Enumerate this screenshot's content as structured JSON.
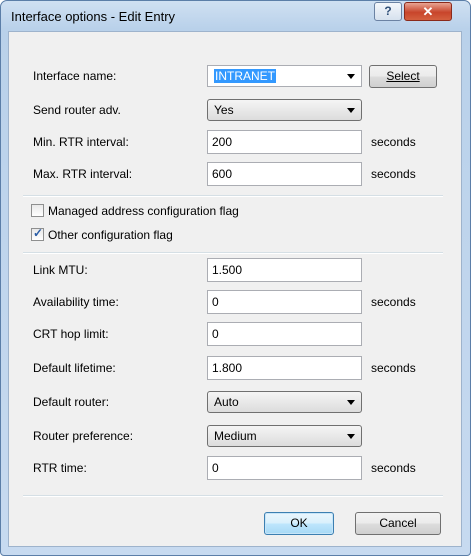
{
  "window": {
    "title": "Interface options - Edit Entry",
    "help_glyph": "?",
    "close_glyph": "✕"
  },
  "form": {
    "interface_name": {
      "label": "Interface name:",
      "value": "INTRANET",
      "select_button": "Select"
    },
    "send_router_adv": {
      "label": "Send router adv.",
      "value": "Yes"
    },
    "min_rtr_interval": {
      "label": "Min. RTR interval:",
      "value": "200",
      "unit": "seconds"
    },
    "max_rtr_interval": {
      "label": "Max. RTR interval:",
      "value": "600",
      "unit": "seconds"
    },
    "managed_flag": {
      "label": "Managed address configuration flag",
      "checked": false
    },
    "other_flag": {
      "label": "Other configuration flag",
      "checked": true,
      "tick": "✓"
    },
    "link_mtu": {
      "label": "Link MTU:",
      "value": "1.500"
    },
    "availability_time": {
      "label": "Availability time:",
      "value": "0",
      "unit": "seconds"
    },
    "crt_hop_limit": {
      "label": "CRT hop limit:",
      "value": "0"
    },
    "default_lifetime": {
      "label": "Default lifetime:",
      "value": "1.800",
      "unit": "seconds"
    },
    "default_router": {
      "label": "Default router:",
      "value": "Auto"
    },
    "router_preference": {
      "label": "Router preference:",
      "value": "Medium"
    },
    "rtr_time": {
      "label": "RTR time:",
      "value": "0",
      "unit": "seconds"
    }
  },
  "buttons": {
    "ok": "OK",
    "cancel": "Cancel"
  }
}
